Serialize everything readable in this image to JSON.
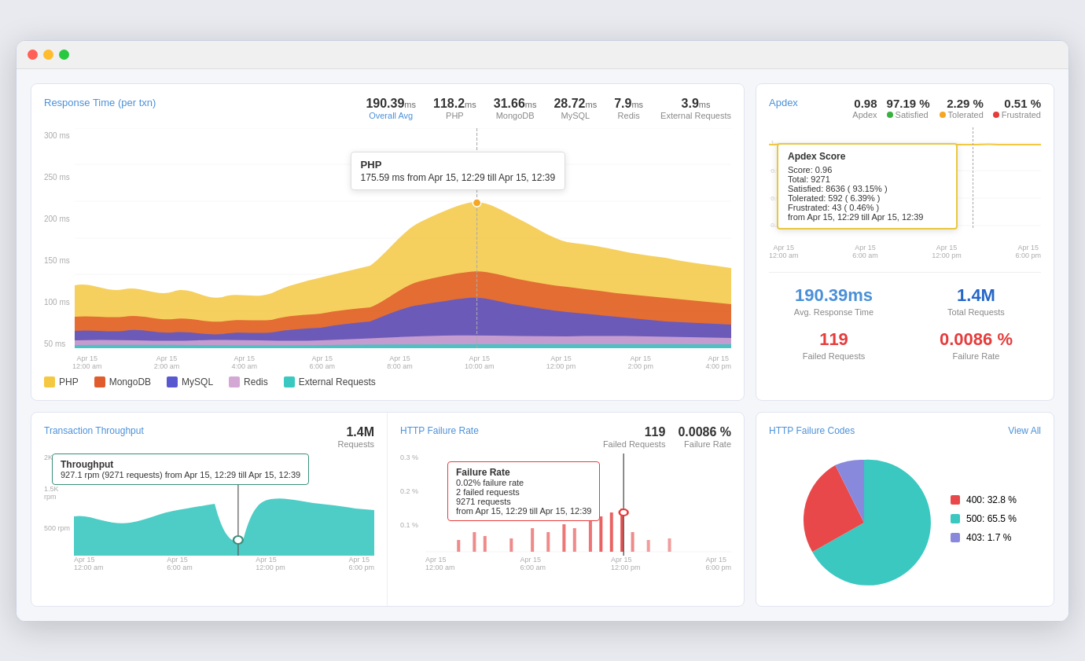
{
  "window": {
    "dots": [
      "red",
      "yellow",
      "green"
    ]
  },
  "response_time": {
    "title": "Response Time (per txn)",
    "metrics": [
      {
        "value": "190.39",
        "unit": "ms",
        "label": "Overall Avg"
      },
      {
        "value": "118.2",
        "unit": "ms",
        "label": "PHP"
      },
      {
        "value": "31.66",
        "unit": "ms",
        "label": "MongoDB"
      },
      {
        "value": "28.72",
        "unit": "ms",
        "label": "MySQL"
      },
      {
        "value": "7.9",
        "unit": "ms",
        "label": "Redis"
      },
      {
        "value": "3.9",
        "unit": "ms",
        "label": "External Requests"
      }
    ],
    "y_labels": [
      "300 ms",
      "250 ms",
      "200 ms",
      "150 ms",
      "100 ms",
      "50 ms"
    ],
    "x_labels": [
      "Apr 15\n12:00 am",
      "Apr 15\n2:00 am",
      "Apr 15\n4:00 am",
      "Apr 15\n6:00 am",
      "Apr 15\n8:00 am",
      "Apr 15\n10:00 am",
      "Apr 15\n12:00 pm",
      "Apr 15\n2:00 pm",
      "Apr 15\n4:00 pm"
    ],
    "tooltip": {
      "title": "PHP",
      "value": "175.59 ms from Apr 15, 12:29 till Apr 15, 12:39"
    },
    "legend": [
      {
        "label": "PHP",
        "color": "#f5c842"
      },
      {
        "label": "MongoDB",
        "color": "#e05c2c"
      },
      {
        "label": "MySQL",
        "color": "#5858d0"
      },
      {
        "label": "Redis",
        "color": "#d4a8d4"
      },
      {
        "label": "External Requests",
        "color": "#3ac8c0"
      }
    ]
  },
  "apdex": {
    "title": "Apdex",
    "metrics": [
      {
        "value": "0.98",
        "label": "Apdex"
      },
      {
        "value": "97.19 %",
        "label": "Satisfied",
        "color": "#3ab040"
      },
      {
        "value": "2.29 %",
        "label": "Tolerated",
        "color": "#f5a623"
      },
      {
        "value": "0.51 %",
        "label": "Frustrated",
        "color": "#e53c3c"
      }
    ],
    "x_labels": [
      "Apr 15\n12:00 am",
      "Apr 15\n6:00 am",
      "Apr 15\n12:00 pm",
      "Apr 15\n6:00 pm"
    ],
    "tooltip": {
      "title": "Apdex Score",
      "score": "Score: 0.96",
      "total": "Total: 9271",
      "satisfied": "Satisfied: 8636 ( 93.15% )",
      "tolerated": "Tolerated: 592 ( 6.39% )",
      "frustrated": "Frustrated: 43 ( 0.46% )",
      "period": "from Apr 15, 12:29 till Apr 15, 12:39"
    },
    "stats": [
      {
        "value": "190.39ms",
        "label": "Avg. Response Time",
        "color": "blue"
      },
      {
        "value": "1.4M",
        "label": "Total Requests",
        "color": "blue-dark"
      },
      {
        "value": "119",
        "label": "Failed Requests",
        "color": "red"
      },
      {
        "value": "0.0086 %",
        "label": "Failure Rate",
        "color": "red"
      }
    ]
  },
  "throughput": {
    "title": "Transaction Throughput",
    "metric": "1.4M",
    "metric_label": "Requests",
    "y_labels": [
      "2K rpm",
      "1.5K rpm",
      "500 rpm"
    ],
    "x_labels": [
      "Apr 15\n12:00 am",
      "Apr 15\n6:00 am",
      "Apr 15\n12:00 pm",
      "Apr 15\n6:00 pm"
    ],
    "tooltip": {
      "title": "Throughput",
      "value": "927.1 rpm (9271 requests) from Apr 15, 12:29 till Apr 15, 12:39"
    }
  },
  "http_failure": {
    "title": "HTTP Failure Rate",
    "failed_requests": "119",
    "failed_label": "Failed Requests",
    "failure_rate": "0.0086 %",
    "failure_rate_label": "Failure Rate",
    "y_labels": [
      "0.3 %",
      "0.2 %",
      "0.1 %"
    ],
    "x_labels": [
      "Apr 15\n12:00 am",
      "Apr 15\n6:00 am",
      "Apr 15\n12:00 pm",
      "Apr 15\n6:00 pm"
    ],
    "tooltip": {
      "title": "Failure Rate",
      "line1": "0.02% failure rate",
      "line2": "2 failed requests",
      "line3": "9271 requests",
      "line4": "from Apr 15, 12:29 till Apr 15, 12:39"
    }
  },
  "http_codes": {
    "title": "HTTP Failure Codes",
    "view_all": "View All",
    "segments": [
      {
        "label": "400: 32.8 %",
        "color": "#e8484a",
        "percent": 32.8
      },
      {
        "label": "500: 65.5 %",
        "color": "#3ac8c0",
        "percent": 65.5
      },
      {
        "label": "403: 1.7 %",
        "color": "#8888dd",
        "percent": 1.7
      }
    ]
  }
}
